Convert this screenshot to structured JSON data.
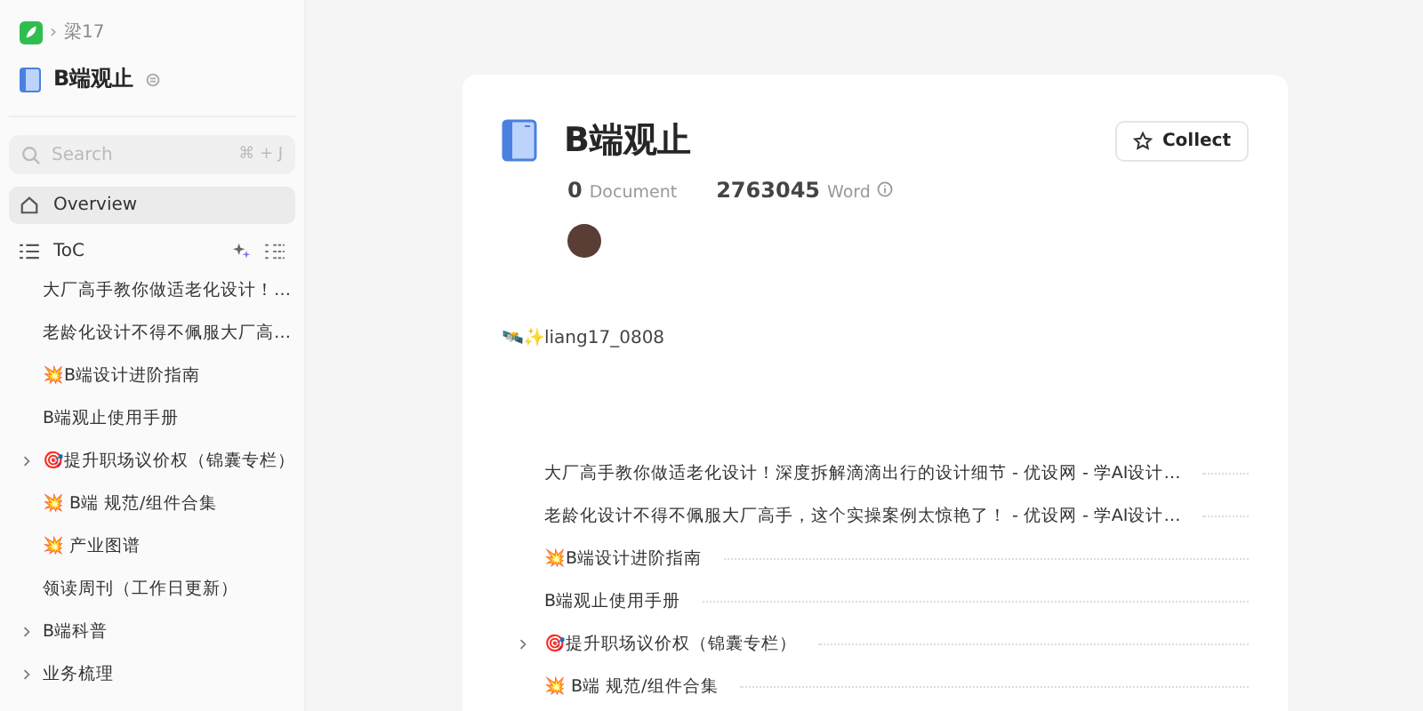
{
  "breadcrumb": {
    "separator": "›",
    "owner": "梁17"
  },
  "sidebar": {
    "title": "B端观止",
    "search": {
      "placeholder": "Search",
      "shortcut": "⌘ + J"
    },
    "nav": [
      {
        "label": "Overview",
        "selected": true
      }
    ],
    "toc_label": "ToC",
    "items": [
      {
        "kind": "doc",
        "label": "大厂高手教你做适老化设计！…"
      },
      {
        "kind": "doc",
        "label": "老龄化设计不得不佩服大厂高…"
      },
      {
        "kind": "doc",
        "label": "💥B端设计进阶指南"
      },
      {
        "kind": "doc",
        "label": "B端观止使用手册"
      },
      {
        "kind": "folder",
        "label": "🎯提升职场议价权（锦囊专栏）"
      },
      {
        "kind": "doc",
        "label": "💥 B端 规范/组件合集"
      },
      {
        "kind": "doc",
        "label": "💥 产业图谱"
      },
      {
        "kind": "doc",
        "label": "领读周刊（工作日更新）"
      },
      {
        "kind": "folder",
        "label": "B端科普"
      },
      {
        "kind": "folder",
        "label": "业务梳理"
      }
    ]
  },
  "book": {
    "title": "B端观止",
    "collect_label": "Collect",
    "documents": "0",
    "documents_label": "Document",
    "words": "2763045",
    "words_label": "Word",
    "author": "🛰️✨liang17_0808",
    "toc": [
      {
        "kind": "doc",
        "label": "大厂高手教你做适老化设计！深度拆解滴滴出行的设计细节 - 优设网 - 学AI设计…"
      },
      {
        "kind": "doc",
        "label": "老龄化设计不得不佩服大厂高手，这个实操案例太惊艳了！ - 优设网 - 学AI设计…"
      },
      {
        "kind": "doc",
        "label": "💥B端设计进阶指南"
      },
      {
        "kind": "doc",
        "label": "B端观止使用手册"
      },
      {
        "kind": "folder",
        "label": "🎯提升职场议价权（锦囊专栏）"
      },
      {
        "kind": "doc",
        "label": "💥 B端 规范/组件合集"
      }
    ]
  }
}
